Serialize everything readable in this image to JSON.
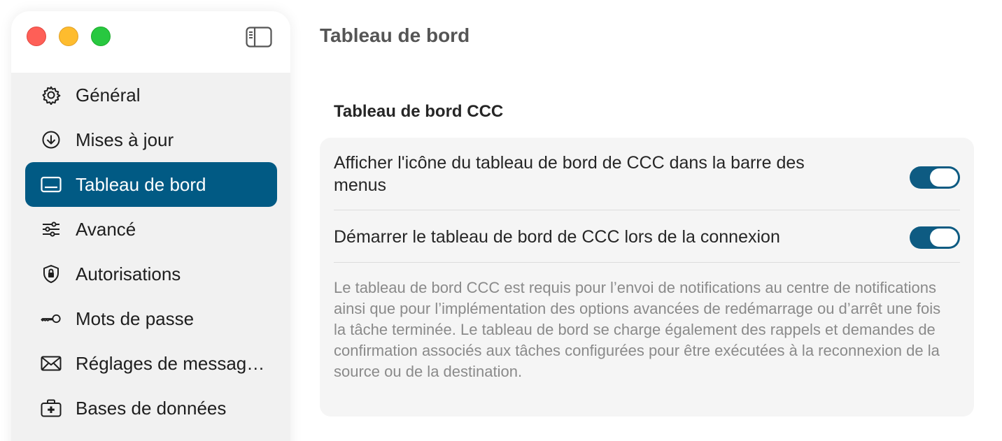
{
  "window": {
    "title": "Tableau de bord",
    "controls": [
      "close",
      "minimize",
      "zoom"
    ]
  },
  "sidebar": {
    "items": [
      {
        "label": "Général",
        "icon": "gear-icon",
        "active": false
      },
      {
        "label": "Mises à jour",
        "icon": "download-circle-icon",
        "active": false
      },
      {
        "label": "Tableau de bord",
        "icon": "dashboard-card-icon",
        "active": true
      },
      {
        "label": "Avancé",
        "icon": "sliders-icon",
        "active": false
      },
      {
        "label": "Autorisations",
        "icon": "shield-lock-icon",
        "active": false
      },
      {
        "label": "Mots de passe",
        "icon": "key-icon",
        "active": false
      },
      {
        "label": "Réglages de messag…",
        "icon": "envelope-icon",
        "active": false
      },
      {
        "label": "Bases de données",
        "icon": "medical-case-icon",
        "active": false
      }
    ]
  },
  "main": {
    "section_title": "Tableau de bord CCC",
    "settings": [
      {
        "label": "Afficher l'icône du tableau de bord de CCC dans la barre des menus",
        "enabled": true
      },
      {
        "label": "Démarrer le tableau de bord de CCC lors de la connexion",
        "enabled": true
      }
    ],
    "description": "Le tableau de bord CCC est requis pour l’envoi de notifications au centre de notifications ainsi que pour l’implémentation des options avancées de redémarrage ou d’arrêt une fois la tâche terminée. Le tableau de bord se charge également des rappels et demandes de confirmation associés aux tâches configurées pour être exécutées à la reconnexion de la source ou de la destination."
  },
  "colors": {
    "accent": "#015a84",
    "toggle_on": "#0e5b82",
    "traffic_close": "#fe5f57",
    "traffic_minimize": "#febc2e",
    "traffic_zoom": "#28c840"
  }
}
